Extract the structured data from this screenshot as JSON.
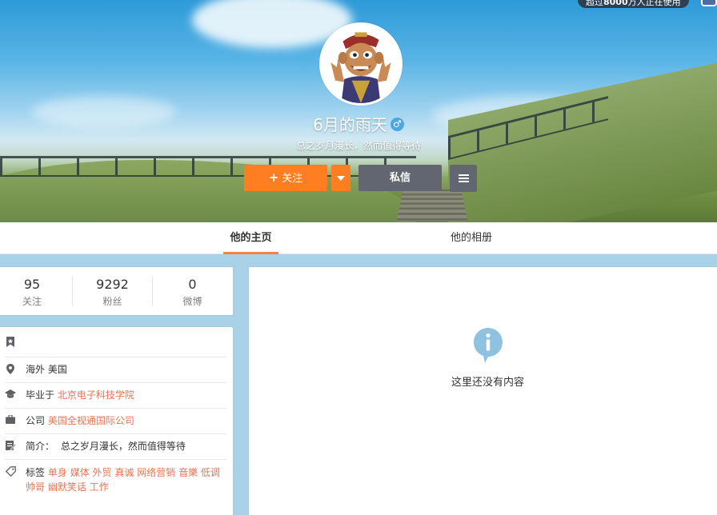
{
  "banner": {
    "pill_prefix": "超过",
    "pill_count": "8000",
    "pill_suffix": "万人正在使用"
  },
  "profile": {
    "username": "6月的雨天",
    "gender_symbol": "♂",
    "tagline": "总之岁月漫长，然而值得等待"
  },
  "actions": {
    "follow_plus": "+",
    "follow_label": "关注",
    "message_label": "私信"
  },
  "tabs": [
    {
      "label": "他的主页",
      "active": true
    },
    {
      "label": "他的相册",
      "active": false
    }
  ],
  "stats": [
    {
      "value": "95",
      "label": "关注"
    },
    {
      "value": "9292",
      "label": "粉丝"
    },
    {
      "value": "0",
      "label": "微博"
    }
  ],
  "info": {
    "location_icon_glyph": "⌖",
    "location": "海外 美国",
    "school_prefix": "毕业于",
    "school": "北京电子科技学院",
    "company_prefix": "公司",
    "company": "美国全视通国际公司",
    "bio_prefix": "简介：",
    "bio": "总之岁月漫长，然而值得等待",
    "tags_prefix": "标签",
    "tags": [
      "单身",
      "媒体",
      "外贸",
      "真诚",
      "网络营销",
      "音樂",
      "低调",
      "帅哥",
      "幽默笑话",
      "工作"
    ]
  },
  "main": {
    "empty_text": "这里还没有内容"
  },
  "colors": {
    "accent": "#ff7e21",
    "link": "#eb7350",
    "dark_button": "#626670",
    "gender": "#4ba6e6",
    "info_icon": "#8fc1e0"
  }
}
